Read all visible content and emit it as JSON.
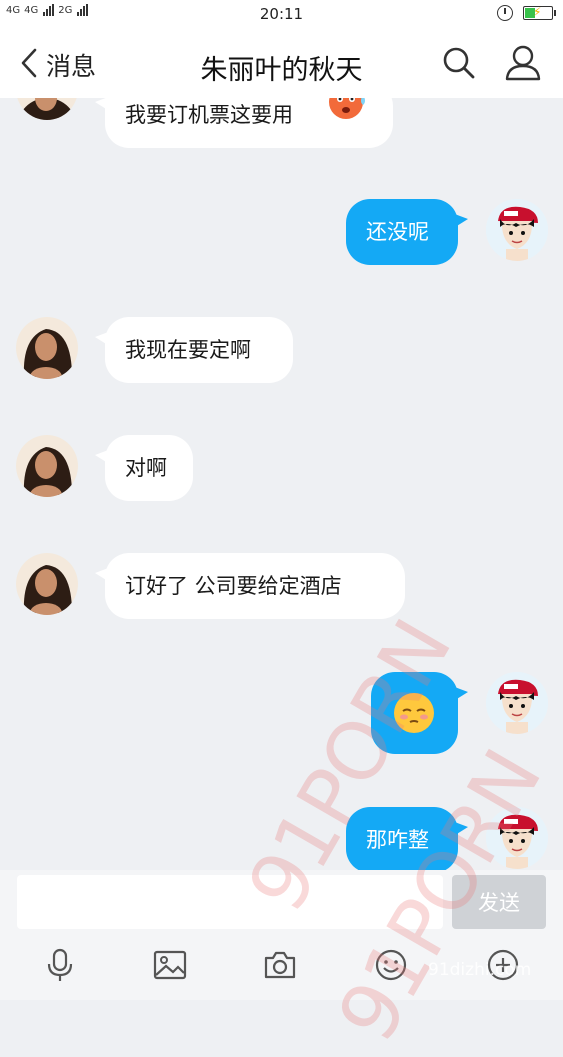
{
  "status_bar": {
    "network_1": "4G",
    "network_2": "4G",
    "network_3": "2G",
    "time": "20:11",
    "icons": [
      "alarm-icon",
      "battery-charging-icon"
    ],
    "battery_color": "#39c24b"
  },
  "nav": {
    "back_label": "消息",
    "title": "朱丽叶的秋天",
    "icons": [
      "chevron-left-icon",
      "search-icon",
      "profile-icon"
    ]
  },
  "messages": [
    {
      "side": "in",
      "text": "我要订机票这要用",
      "emoji": "sweat-face-icon"
    },
    {
      "side": "out",
      "text": "还没呢"
    },
    {
      "side": "in",
      "text": "我现在要定啊"
    },
    {
      "side": "in",
      "text": "对啊"
    },
    {
      "side": "in",
      "text": "订好了  公司要给定酒店"
    },
    {
      "side": "out",
      "text": "",
      "emoji": "sleepy-face-icon"
    },
    {
      "side": "out",
      "text": "那咋整"
    }
  ],
  "composer": {
    "input_value": "",
    "send_label": "发送",
    "tools": [
      "microphone-icon",
      "image-icon",
      "camera-icon",
      "emoji-icon",
      "plus-icon"
    ]
  },
  "watermarks": {
    "main_1": "91PORN",
    "main_2": "91PORN",
    "site": "91dizhi.com"
  },
  "colors": {
    "accent": "#14a9f5",
    "chat_bg": "#eef0f3",
    "send_disabled": "#cfd2d6"
  }
}
